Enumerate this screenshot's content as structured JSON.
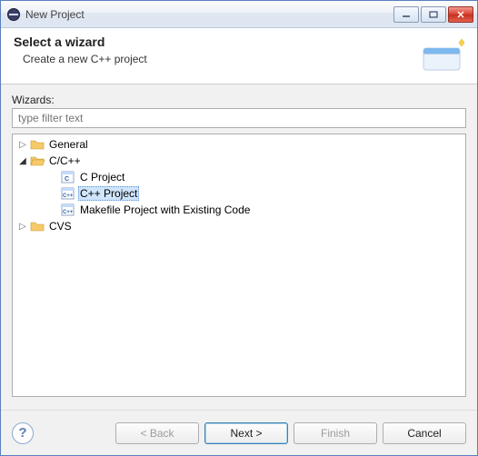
{
  "window": {
    "title": "New Project"
  },
  "header": {
    "title": "Select a wizard",
    "subtitle": "Create a new C++ project"
  },
  "filter": {
    "label": "Wizards:",
    "placeholder": "type filter text"
  },
  "tree": {
    "nodes": [
      {
        "label": "General",
        "icon": "folder",
        "expanded": false,
        "level": 1,
        "hasChildren": true
      },
      {
        "label": "C/C++",
        "icon": "folder-open",
        "expanded": true,
        "level": 1,
        "hasChildren": true
      },
      {
        "label": "C Project",
        "icon": "file-c",
        "level": 2,
        "hasChildren": false
      },
      {
        "label": "C++ Project",
        "icon": "file-cpp",
        "level": 2,
        "hasChildren": false,
        "selected": true
      },
      {
        "label": "Makefile Project with Existing Code",
        "icon": "file-make",
        "level": 2,
        "hasChildren": false
      },
      {
        "label": "CVS",
        "icon": "folder",
        "expanded": false,
        "level": 1,
        "hasChildren": true
      }
    ]
  },
  "buttons": {
    "back": "< Back",
    "next": "Next >",
    "finish": "Finish",
    "cancel": "Cancel"
  }
}
